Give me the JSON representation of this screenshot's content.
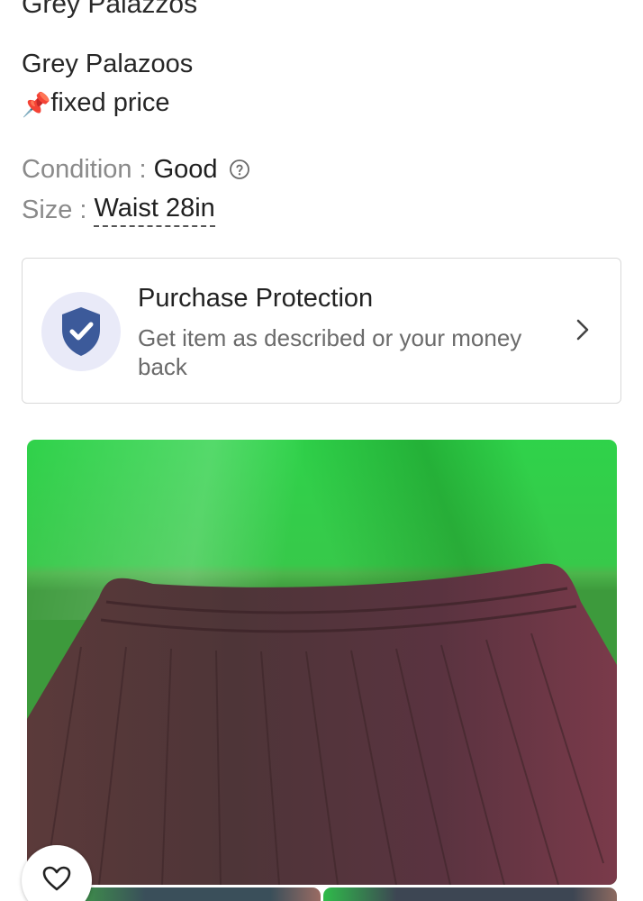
{
  "listing": {
    "title": "Grey Palazzos",
    "description_line1": "Grey Palazoos",
    "pin_emoji": "📌",
    "description_line2": "fixed price"
  },
  "attributes": {
    "condition": {
      "key": "Condition",
      "separator": ":",
      "value": "Good",
      "icon": "help-circle-icon"
    },
    "size": {
      "key": "Size",
      "separator": ":",
      "value": "Waist 28in"
    }
  },
  "purchase_protection": {
    "icon": "shield-check-icon",
    "title": "Purchase Protection",
    "subtitle": "Get item as described or your money back",
    "chevron_icon": "chevron-right-icon",
    "colors": {
      "shield": "#3c5a9a",
      "shield_bg": "#e9eaf8"
    }
  },
  "gallery": {
    "main_image_subject": "brown pleated elastic-waist palazzo on green sheet",
    "thumbnail_count": 2,
    "like_icon": "heart-outline-icon"
  }
}
